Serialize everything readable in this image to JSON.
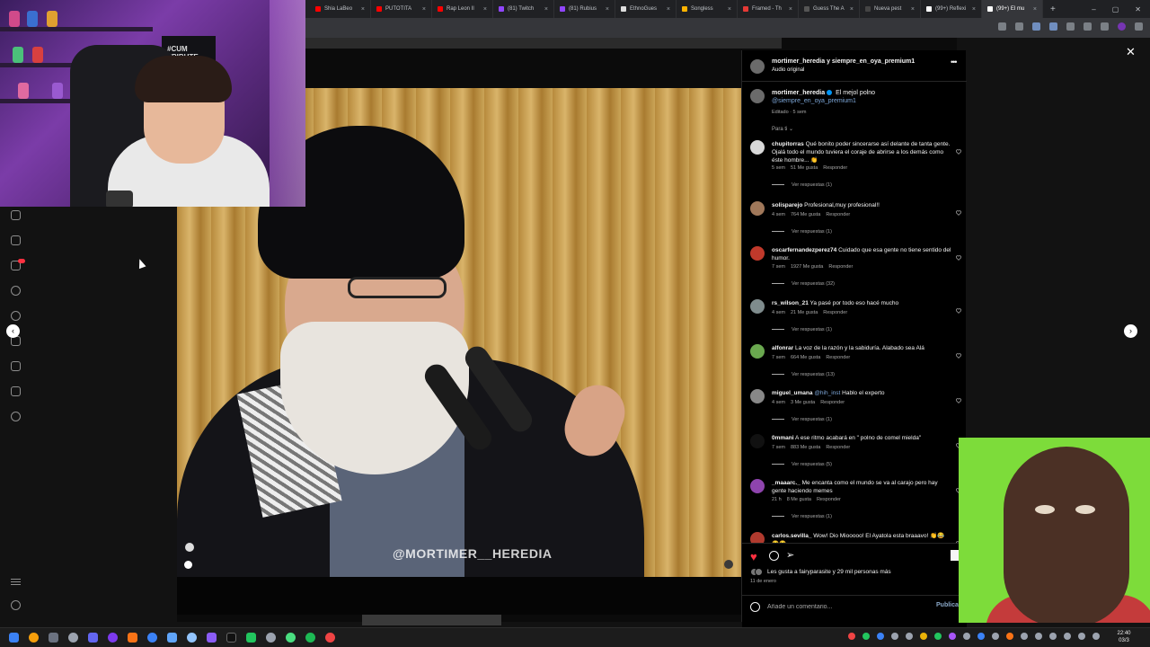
{
  "browser": {
    "tabs": [
      {
        "label": "Shia LaBeo",
        "favicon_color": "#ff0000"
      },
      {
        "label": "PUTOTITA",
        "favicon_color": "#ff0000"
      },
      {
        "label": "Rap Leon Il",
        "favicon_color": "#ff0000"
      },
      {
        "label": "(81) Twitch",
        "favicon_color": "#9146ff"
      },
      {
        "label": "(81) Rubius",
        "favicon_color": "#9146ff"
      },
      {
        "label": "EthnoGues",
        "favicon_color": "#dddddd"
      },
      {
        "label": "Songless",
        "favicon_color": "#ffb300"
      },
      {
        "label": "Framed - Th",
        "favicon_color": "#e53935"
      },
      {
        "label": "Guess The A",
        "favicon_color": "#555555"
      },
      {
        "label": "Nueva pest",
        "favicon_color": "#444444"
      },
      {
        "label": "(99+) Reflexi",
        "favicon_color": "#ffffff"
      },
      {
        "label": "(99+) El mu",
        "favicon_color": "#ffffff"
      }
    ],
    "new_tab": "+"
  },
  "video": {
    "watermark": "@MORTIMER__HEREDIA"
  },
  "post": {
    "header_title": "mortimer_heredia y siempre_en_oya_premium1",
    "header_sub": "Audio original",
    "caption_user": "mortimer_heredia",
    "caption_text": "El mejol polno",
    "caption_mention": "@siempre_en_oya_premium1",
    "caption_meta": "Editado · 5 sem",
    "sort_label": "Para ti ⌄",
    "comments": [
      {
        "user": "chupitorras",
        "text": "Qué bonito poder sincerarse así delante de tanta gente. Ojalá todo el mundo tuviera el coraje de abrirse a los demás como éste hombre... 👏",
        "time": "5 sem",
        "likes": "51 Me gusta",
        "reply": "Responder",
        "replies": "Ver respuestas (1)"
      },
      {
        "user": "solisparejo",
        "text": "Profesional,muy profesional!!",
        "time": "4 sem",
        "likes": "764 Me gusta",
        "reply": "Responder",
        "replies": "Ver respuestas (1)"
      },
      {
        "user": "oscarfernandezperez74",
        "text": "Cuidado que esa gente no tiene sentido del humor.",
        "time": "7 sem",
        "likes": "1927 Me gusta",
        "reply": "Responder",
        "replies": "Ver respuestas (32)"
      },
      {
        "user": "rs_wilson_21",
        "text": "Ya pasé por todo eso hacé mucho",
        "time": "4 sem",
        "likes": "21 Me gusta",
        "reply": "Responder",
        "replies": "Ver respuestas (1)"
      },
      {
        "user": "alfonrar",
        "text": "La voz de la razón y la sabiduría. Alabado sea Alá",
        "time": "7 sem",
        "likes": "664 Me gusta",
        "reply": "Responder",
        "replies": "Ver respuestas (13)"
      },
      {
        "user": "miguel_umana",
        "mention": "@hih_inst",
        "text": "Hablo el experto",
        "time": "4 sem",
        "likes": "3 Me gusta",
        "reply": "Responder",
        "replies": "Ver respuestas (1)"
      },
      {
        "user": "0mmani",
        "text": "A ese ritmo acabará en \" polno de comel mielda\"",
        "time": "7 sem",
        "likes": "883 Me gusta",
        "reply": "Responder",
        "replies": "Ver respuestas (5)"
      },
      {
        "user": "_maaarc._",
        "text": "Me encanta como el mundo se va al carajo pero hay gente haciendo memes",
        "time": "21 h",
        "likes": "8 Me gusta",
        "reply": "Responder",
        "replies": "Ver respuestas (1)"
      },
      {
        "user": "carlos.sevilla_",
        "text": "Wow! Dio Miooooo! El Ayatola esta braaavo! 👏😂😂😂",
        "time": "",
        "likes": "",
        "reply": "",
        "replies": ""
      }
    ],
    "likes_text": "Les gusta a fairyparasite y 29 mil personas más",
    "date": "11 de enero",
    "comment_placeholder": "Añade un comentario...",
    "post_button": "Publicar"
  },
  "nav": {
    "close": "✕",
    "prev": "‹",
    "next": "›"
  },
  "webcam": {
    "poster_text": "#CUM TRIBUTE"
  },
  "taskbar": {
    "time": "22:40",
    "date": "03/3"
  }
}
